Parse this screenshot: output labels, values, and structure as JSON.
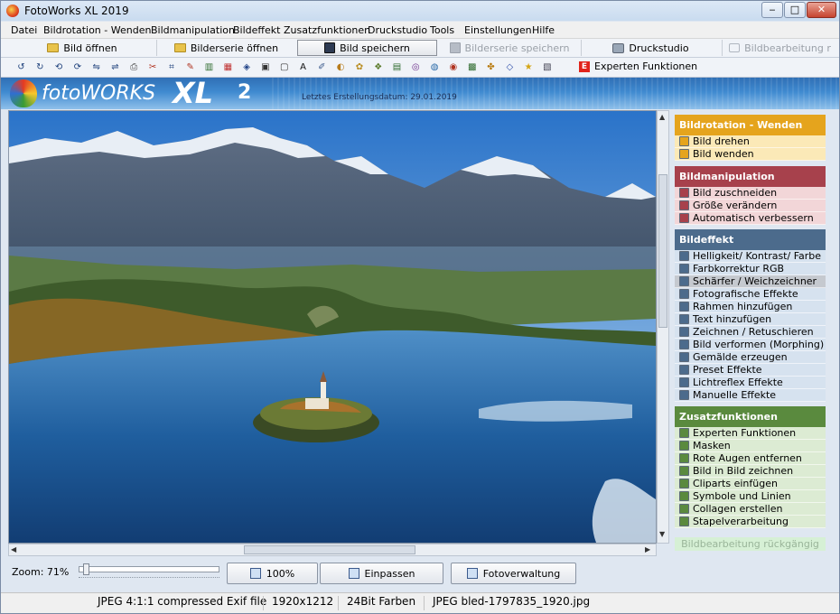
{
  "window": {
    "title": "FotoWorks XL 2019",
    "controls": [
      "‒",
      "□",
      "✕"
    ]
  },
  "menu": [
    "Datei",
    "Bildrotation - Wenden",
    "Bildmanipulation",
    "Bildeffekt",
    "Zusatzfunktionen",
    "Druckstudio",
    "Tools",
    "Einstellungen",
    "Hilfe"
  ],
  "toolbar": {
    "open": "Bild öffnen",
    "open_series": "Bilderserie öffnen",
    "save": "Bild speichern",
    "save_series": "Bilderserie speichern",
    "print_studio": "Druckstudio",
    "edit": "Bildbearbeitung r",
    "expert": "Experten Funktionen",
    "expert_badge": "E"
  },
  "icons_toolbar": [
    "rotate-left-icon",
    "rotate-right-icon",
    "rotate-ccw-icon",
    "rotate-cw-icon",
    "flip-icon",
    "mirror-icon",
    "print-icon",
    "cut-icon",
    "crop-icon",
    "wand-icon",
    "levels-icon",
    "rgb-icon",
    "sharpen-icon",
    "frame-icon",
    "frame2-icon",
    "text-icon",
    "draw-icon",
    "morph-icon",
    "paint-icon",
    "preset-icon",
    "landscape-icon",
    "lens-icon",
    "mask-icon",
    "red-eye-icon",
    "pip-icon",
    "clipart-icon",
    "shapes-icon",
    "collage-icon",
    "batch-icon"
  ],
  "banner": {
    "logo_foto": "foto",
    "logo_works": "WORKS",
    "logo_xl": "XL",
    "logo_num": "2",
    "build_date": "Letztes Erstellungsdatum: 29.01.2019"
  },
  "bottom": {
    "zoom_label": "Zoom: 71%",
    "zoom_value": 0.03,
    "btn_100": "100%",
    "btn_fit": "Einpassen",
    "btn_manage": "Fotoverwaltung"
  },
  "sidebar": {
    "sections": [
      {
        "title": "Bildrotation - Wenden",
        "color": "#e5a41d",
        "itemcolor": "#fbe9b7",
        "items": [
          "Bild drehen",
          "Bild wenden"
        ]
      },
      {
        "title": "Bildmanipulation",
        "color": "#a7414c",
        "itemcolor": "#f2d6d8",
        "items": [
          "Bild zuschneiden",
          "Größe verändern",
          "Automatisch verbessern"
        ]
      },
      {
        "title": "Bildeffekt",
        "color": "#4c6b8c",
        "itemcolor": "#d6e2ef",
        "items": [
          "Helligkeit/ Kontrast/ Farbe",
          "Farbkorrektur RGB",
          "Schärfer / Weichzeichner",
          "Fotografische Effekte",
          "Rahmen hinzufügen",
          "Text hinzufügen",
          "Zeichnen / Retuschieren",
          "Bild verformen (Morphing)",
          "Gemälde erzeugen",
          "Preset Effekte",
          "Lichtreflex Effekte",
          "Manuelle Effekte"
        ]
      },
      {
        "title": "Zusatzfunktionen",
        "color": "#5a8a3e",
        "itemcolor": "#dcebd3",
        "items": [
          "Experten Funktionen",
          "Masken",
          "Rote Augen entfernen",
          "Bild in Bild zeichnen",
          "Cliparts einfügen",
          "Symbole und Linien",
          "Collagen erstellen",
          "Stapelverarbeitung"
        ]
      }
    ],
    "undo": "Bildbearbeitung rückgängig"
  },
  "status": {
    "format": "JPEG 4:1:1 compressed Exif file",
    "size": "1920x1212",
    "depth": "24Bit Farben",
    "file": "JPEG bled-1797835_1920.jpg"
  }
}
